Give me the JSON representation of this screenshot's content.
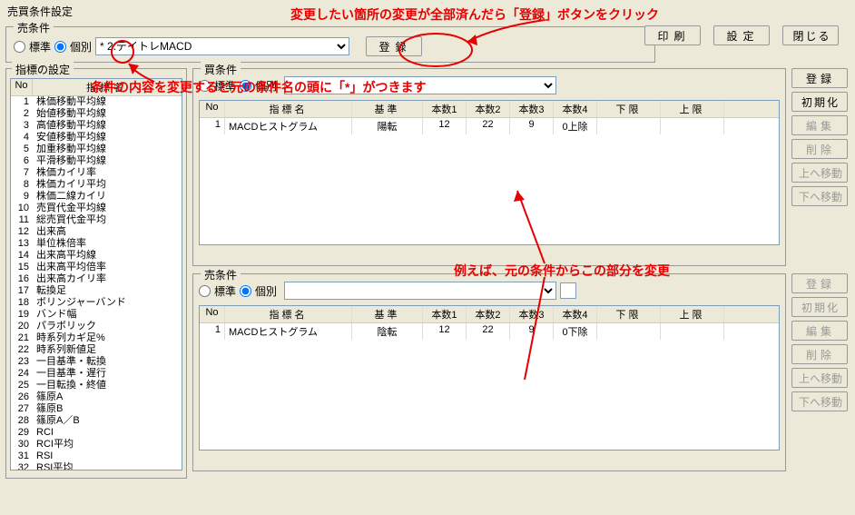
{
  "window_title": "売買条件設定",
  "top_fieldset": {
    "label": "売条件",
    "radio_standard": "標準",
    "radio_individual": "個別",
    "selected_condition": "* 2:デイトレMACD",
    "register": "登録"
  },
  "top_buttons": {
    "print": "印刷",
    "settings": "設定",
    "close": "閉じる"
  },
  "indicator_panel": {
    "label": "指標の設定",
    "header_no": "No",
    "header_name": "指標名",
    "items": [
      "株価移動平均線",
      "始値移動平均線",
      "高値移動平均線",
      "安値移動平均線",
      "加重移動平均線",
      "平滑移動平均線",
      "株価カイリ率",
      "株価カイリ平均",
      "株価二線カイリ",
      "売買代金平均線",
      "総売買代金平均",
      "出来高",
      "単位株倍率",
      "出来高平均線",
      "出来高平均倍率",
      "出来高カイリ率",
      "転換足",
      "ボリンジャーバンド",
      "バンド幅",
      "パラボリック",
      "時系列カギ足%",
      "時系列新値足",
      "一目基準・転換",
      "一目基準・遅行",
      "一目転換・終値",
      "篠原A",
      "篠原B",
      "篠原A／B",
      "RCI",
      "RCI平均",
      "RSI",
      "RSI平均"
    ]
  },
  "buy_box": {
    "label": "買条件",
    "radio_standard": "標準",
    "radio_individual": "個別"
  },
  "sell_box": {
    "label": "売条件",
    "radio_standard": "標準",
    "radio_individual": "個別"
  },
  "side_buttons": {
    "register": "登録",
    "init": "初期化",
    "edit": "編集",
    "delete": "削除",
    "move_up": "上へ移動",
    "move_down": "下へ移動"
  },
  "table_headers": {
    "no": "No",
    "name": "指標名",
    "std": "基準",
    "n1": "本数1",
    "n2": "本数2",
    "n3": "本数3",
    "n4": "本数4",
    "lo": "下限",
    "hi": "上限"
  },
  "buy_row": {
    "no": "1",
    "name": "MACDヒストグラム",
    "std": "陽転",
    "n1": "12",
    "n2": "22",
    "n3": "9",
    "n4": "0上除"
  },
  "sell_row": {
    "no": "1",
    "name": "MACDヒストグラム",
    "std": "陰転",
    "n1": "12",
    "n2": "22",
    "n3": "9",
    "n4": "0下除"
  },
  "annotations": {
    "a1": "変更したい箇所の変更が全部済んだら「登録」ボタンをクリック",
    "a2": "条件の内容を変更すると元の条件名の頭に「*」がつきます",
    "a3": "例えば、元の条件からこの部分を変更"
  }
}
